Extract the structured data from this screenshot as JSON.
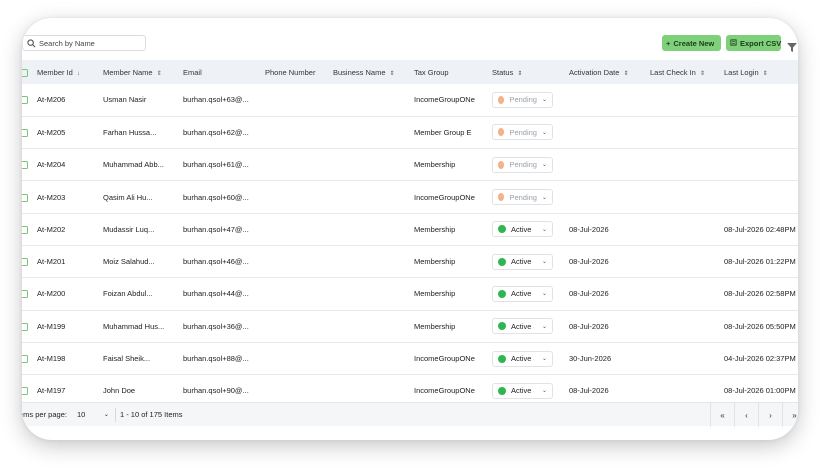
{
  "search": {
    "placeholder": "Search by Name"
  },
  "toolbar": {
    "create_label": "Create New",
    "export_label": "Export CSV"
  },
  "colors": {
    "accent": "#7fd07a",
    "active": "#2fb551",
    "pending": "#f2b38a",
    "header_bg": "#eef2f7"
  },
  "columns": [
    "Member Id",
    "Member Name",
    "Email",
    "Phone Number",
    "Business Name",
    "Tax Group",
    "Status",
    "Activation Date",
    "Last Check In",
    "Last Login"
  ],
  "rows": [
    {
      "id": "At-M206",
      "name": "Usman Nasir",
      "email": "burhan.qsol+63@...",
      "phone": "",
      "business": "",
      "tax": "IncomeGroupONe",
      "status": "Pending",
      "activation": "",
      "checkin": "",
      "login": ""
    },
    {
      "id": "At-M205",
      "name": "Farhan Hussa...",
      "email": "burhan.qsol+62@...",
      "phone": "",
      "business": "",
      "tax": "Member Group E",
      "status": "Pending",
      "activation": "",
      "checkin": "",
      "login": ""
    },
    {
      "id": "At-M204",
      "name": "Muhammad Abb...",
      "email": "burhan.qsol+61@...",
      "phone": "",
      "business": "",
      "tax": "Membership",
      "status": "Pending",
      "activation": "",
      "checkin": "",
      "login": ""
    },
    {
      "id": "At-M203",
      "name": "Qasim Ali Hu...",
      "email": "burhan.qsol+60@...",
      "phone": "",
      "business": "",
      "tax": "IncomeGroupONe",
      "status": "Pending",
      "activation": "",
      "checkin": "",
      "login": ""
    },
    {
      "id": "At-M202",
      "name": "Mudassir Luq...",
      "email": "burhan.qsol+47@...",
      "phone": "",
      "business": "",
      "tax": "Membership",
      "status": "Active",
      "activation": "08-Jul-2026",
      "checkin": "",
      "login": "08-Jul-2026 02:48PM"
    },
    {
      "id": "At-M201",
      "name": "Moiz Salahud...",
      "email": "burhan.qsol+46@...",
      "phone": "",
      "business": "",
      "tax": "Membership",
      "status": "Active",
      "activation": "08-Jul-2026",
      "checkin": "",
      "login": "08-Jul-2026 01:22PM"
    },
    {
      "id": "At-M200",
      "name": "Foizan Abdul...",
      "email": "burhan.qsol+44@...",
      "phone": "",
      "business": "",
      "tax": "Membership",
      "status": "Active",
      "activation": "08-Jul-2026",
      "checkin": "",
      "login": "08-Jul-2026 02:58PM"
    },
    {
      "id": "At-M199",
      "name": "Muhammad Hus...",
      "email": "burhan.qsol+36@...",
      "phone": "",
      "business": "",
      "tax": "Membership",
      "status": "Active",
      "activation": "08-Jul-2026",
      "checkin": "",
      "login": "08-Jul-2026 05:50PM"
    },
    {
      "id": "At-M198",
      "name": "Faisal Sheik...",
      "email": "burhan.qsol+88@...",
      "phone": "",
      "business": "",
      "tax": "IncomeGroupONe",
      "status": "Active",
      "activation": "30-Jun-2026",
      "checkin": "",
      "login": "04-Jul-2026 02:37PM"
    },
    {
      "id": "At-M197",
      "name": "John Doe",
      "email": "burhan.qsol+90@...",
      "phone": "",
      "business": "",
      "tax": "IncomeGroupONe",
      "status": "Active",
      "activation": "08-Jul-2026",
      "checkin": "",
      "login": "08-Jul-2026 01:00PM"
    }
  ],
  "footer": {
    "per_page_label": "ems per page:",
    "per_page_value": "10",
    "range_text": "1 - 10 of 175 Items"
  },
  "icons": {
    "search": "search-icon",
    "plus": "plus-icon",
    "export": "export-icon",
    "filter": "filter-icon",
    "sort": "sort-icon",
    "chevron": "chevron-down-icon"
  }
}
